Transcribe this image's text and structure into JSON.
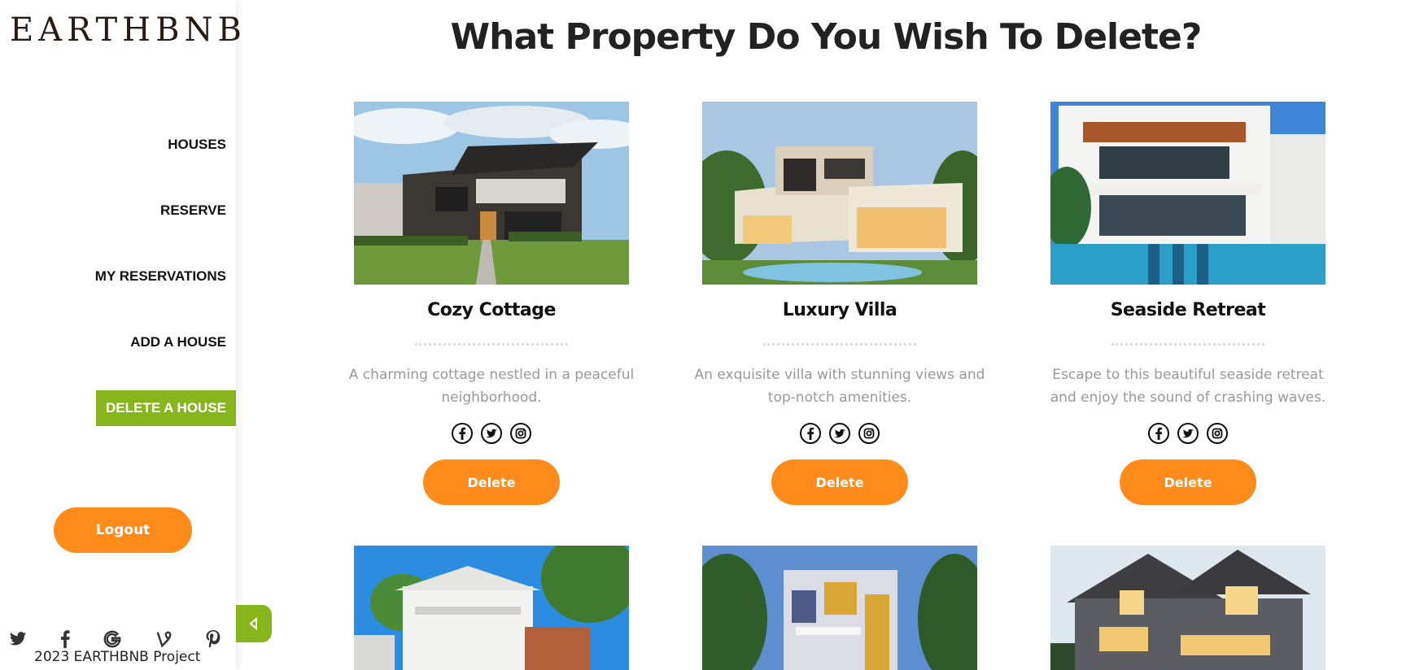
{
  "brand": "EARTHBNB",
  "nav": {
    "items": [
      {
        "label": "HOUSES"
      },
      {
        "label": "RESERVE"
      },
      {
        "label": "MY RESERVATIONS"
      },
      {
        "label": "ADD A HOUSE"
      },
      {
        "label": "DELETE A HOUSE",
        "active": true
      }
    ],
    "logout_label": "Logout"
  },
  "socials": [
    "twitter-icon",
    "facebook-icon",
    "google-icon",
    "vine-icon",
    "pinterest-icon"
  ],
  "footer": {
    "text": "2023 EARTHBNB Project"
  },
  "page": {
    "title": "What Property Do You Wish To Delete?"
  },
  "properties": [
    {
      "name": "Cozy Cottage",
      "description": "A charming cottage nestled in a peaceful neighborhood.",
      "button": "Delete"
    },
    {
      "name": "Luxury Villa",
      "description": "An exquisite villa with stunning views and top-notch amenities.",
      "button": "Delete"
    },
    {
      "name": "Seaside Retreat",
      "description": "Escape to this beautiful seaside retreat and enjoy the sound of crashing waves.",
      "button": "Delete"
    }
  ],
  "colors": {
    "accent_orange": "#ff8c1a",
    "accent_green": "#86b61c"
  }
}
